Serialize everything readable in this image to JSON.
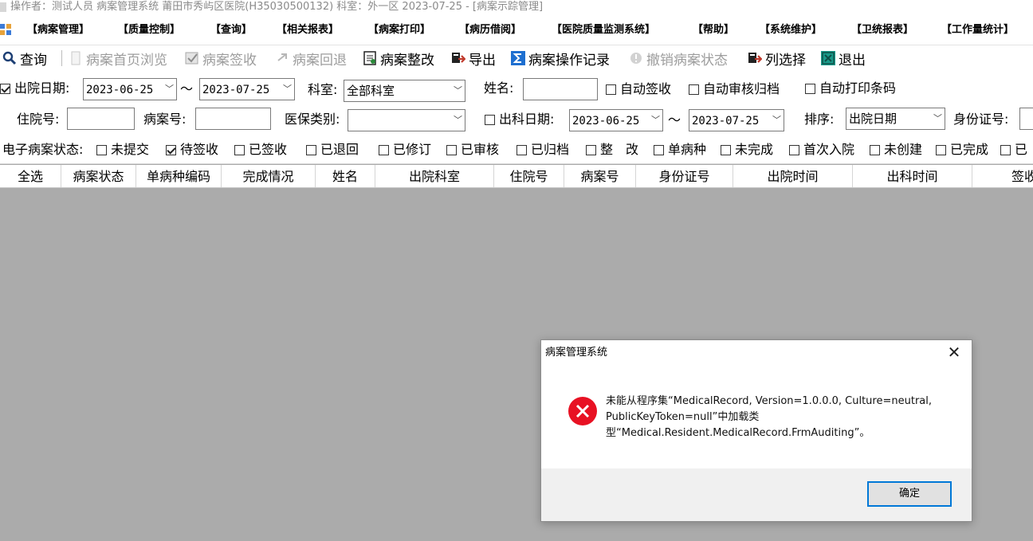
{
  "window": {
    "title": "操作者：测试人员 病案管理系统  莆田市秀屿区医院(H35030500132)  科室：外一区 2023-07-25  - [病案示踪管理]"
  },
  "menu": [
    "【病案管理】",
    "【质量控制】",
    "【查询】",
    "【相关报表】",
    "【病案打印】",
    "【病历借阅】",
    "【医院质量监测系统】",
    "【帮助】",
    "【系统维护】",
    "【卫统报表】",
    "【工作量统计】"
  ],
  "toolbar": {
    "query": "查询",
    "homepage_browse": "病案首页浏览",
    "record_signoff": "病案签收",
    "record_return": "病案回退",
    "record_rectify": "病案整改",
    "export": "导出",
    "operation_log": "病案操作记录",
    "revoke_status": "撤销病案状态",
    "column_select": "列选择",
    "exit": "退出",
    "colors": {
      "exit_icon": "#1a9a8a",
      "log_icon": "#1e6fd0"
    }
  },
  "filters": {
    "discharge_date_label": "出院日期:",
    "discharge_date_checked": true,
    "discharge_from": "2023-06-25",
    "discharge_to": "2023-07-25",
    "tilde": "～",
    "dept_label": "科室:",
    "dept_value": "全部科室",
    "name_label": "姓名:",
    "name_value": "",
    "auto_signoff": "自动签收",
    "auto_audit_archive": "自动审核归档",
    "auto_print_barcode": "自动打印条码",
    "inpatient_no_label": "住院号:",
    "inpatient_no_value": "",
    "record_no_label": "病案号:",
    "record_no_value": "",
    "insurance_label": "医保类别:",
    "insurance_value": "",
    "dept_out_date_label": "出科日期:",
    "dept_out_checked": false,
    "dept_out_from": "2023-06-25",
    "dept_out_to": "2023-07-25",
    "sort_label": "排序:",
    "sort_value": "出院日期",
    "id_card_label": "身份证号:",
    "id_card_value": "",
    "emr_status_label": "电子病案状态:",
    "statuses": [
      {
        "label": "未提交",
        "checked": false
      },
      {
        "label": "待签收",
        "checked": true
      },
      {
        "label": "已签收",
        "checked": false
      },
      {
        "label": "已退回",
        "checked": false
      },
      {
        "label": "已修订",
        "checked": false
      },
      {
        "label": "已审核",
        "checked": false
      },
      {
        "label": "已归档",
        "checked": false
      },
      {
        "label": "整　改",
        "checked": false
      },
      {
        "label": "单病种",
        "checked": false
      },
      {
        "label": "未完成",
        "checked": false
      },
      {
        "label": "首次入院",
        "checked": false
      },
      {
        "label": "未创建",
        "checked": false
      },
      {
        "label": "已完成",
        "checked": false
      },
      {
        "label": "已",
        "checked": false
      }
    ]
  },
  "grid": {
    "columns": [
      "全选",
      "病案状态",
      "单病种编码",
      "完成情况",
      "姓名",
      "出院科室",
      "住院号",
      "病案号",
      "身份证号",
      "出院时间",
      "出科时间",
      "签收"
    ]
  },
  "dialog": {
    "title": "病案管理系统",
    "message": "未能从程序集“MedicalRecord, Version=1.0.0.0, Culture=neutral, PublicKeyToken=null”中加载类型“Medical.Resident.MedicalRecord.FrmAuditing”。",
    "ok_label": "确定",
    "close_glyph": "✕",
    "icon": "error-icon",
    "colors": {
      "error_red": "#e81123",
      "ok_border": "#0078d7"
    }
  }
}
